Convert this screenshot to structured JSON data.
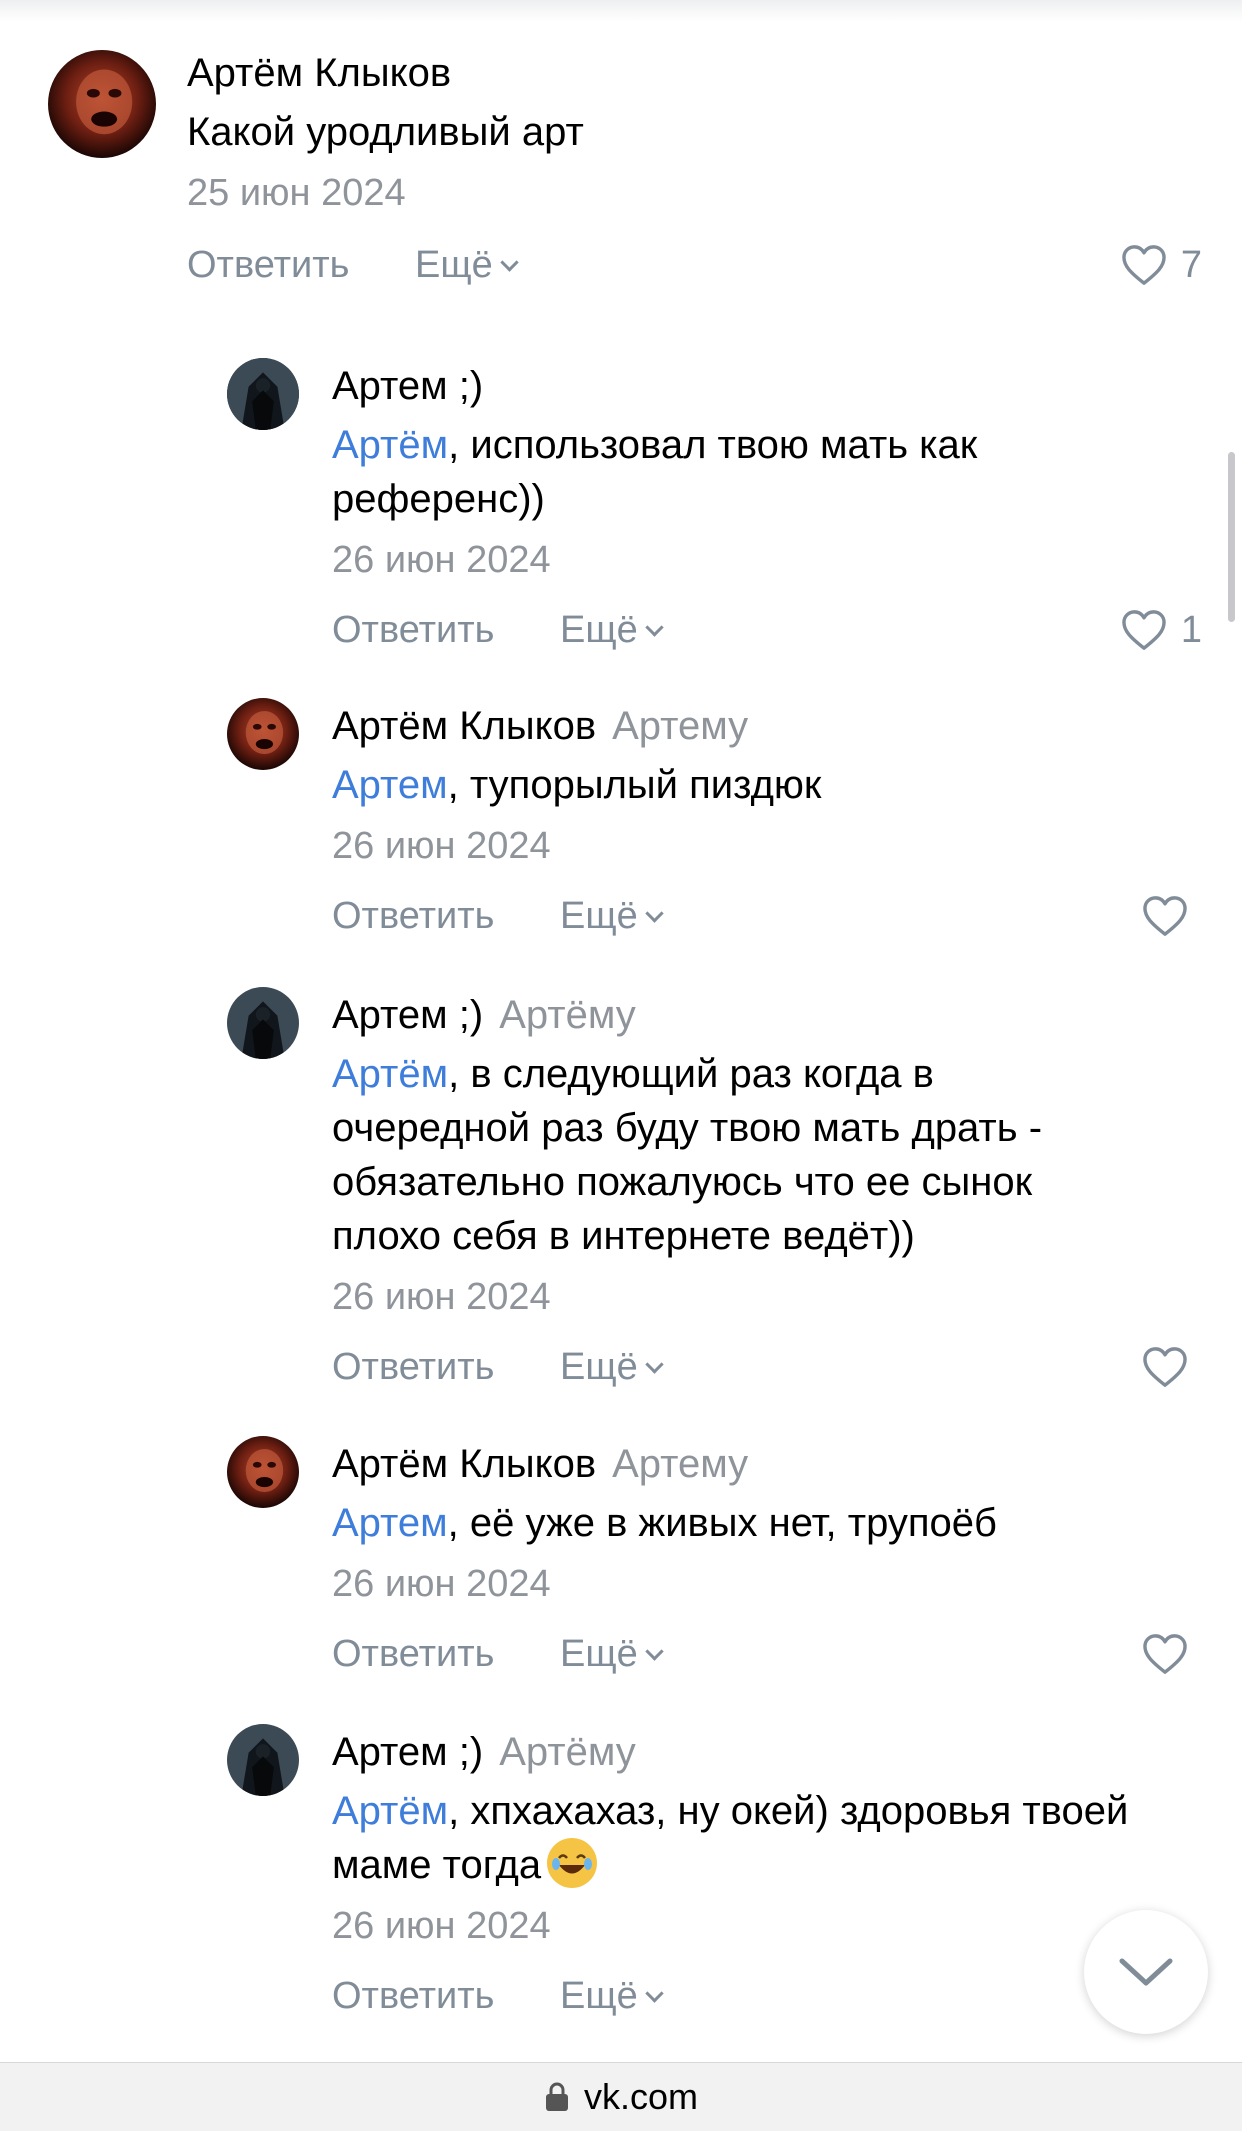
{
  "browser": {
    "url": "vk.com"
  },
  "actions": {
    "reply_label": "Ответить",
    "more_label": "Ещё"
  },
  "comments": [
    {
      "author": "Артём Клыков",
      "reply_to": "",
      "mention": "",
      "text": "Какой уродливый арт",
      "date": "25 июн 2024",
      "likes": "7"
    },
    {
      "author": "Артем ;)",
      "reply_to": "",
      "mention": "Артём",
      "text": ", использовал твою мать как референс))",
      "date": "26 июн 2024",
      "likes": "1"
    },
    {
      "author": "Артём Клыков",
      "reply_to": "Артему",
      "mention": "Артем",
      "text": ", тупорылый пиздюк",
      "date": "26 июн 2024",
      "likes": ""
    },
    {
      "author": "Артем ;)",
      "reply_to": "Артёму",
      "mention": "Артём",
      "text": ", в следующий раз когда в очередной раз буду твою мать драть - обязательно пожалуюсь что ее сынок плохо себя в интернете ведёт))",
      "date": "26 июн 2024",
      "likes": ""
    },
    {
      "author": "Артём Клыков",
      "reply_to": "Артему",
      "mention": "Артем",
      "text": ", её уже в живых нет, трупоёб",
      "date": "26 июн 2024",
      "likes": ""
    },
    {
      "author": "Артем ;)",
      "reply_to": "Артёму",
      "mention": "Артём",
      "text": ", хпхахахаз, ну окей) здоровья твоей маме тогда",
      "date": "26 июн 2024",
      "likes": ""
    }
  ]
}
